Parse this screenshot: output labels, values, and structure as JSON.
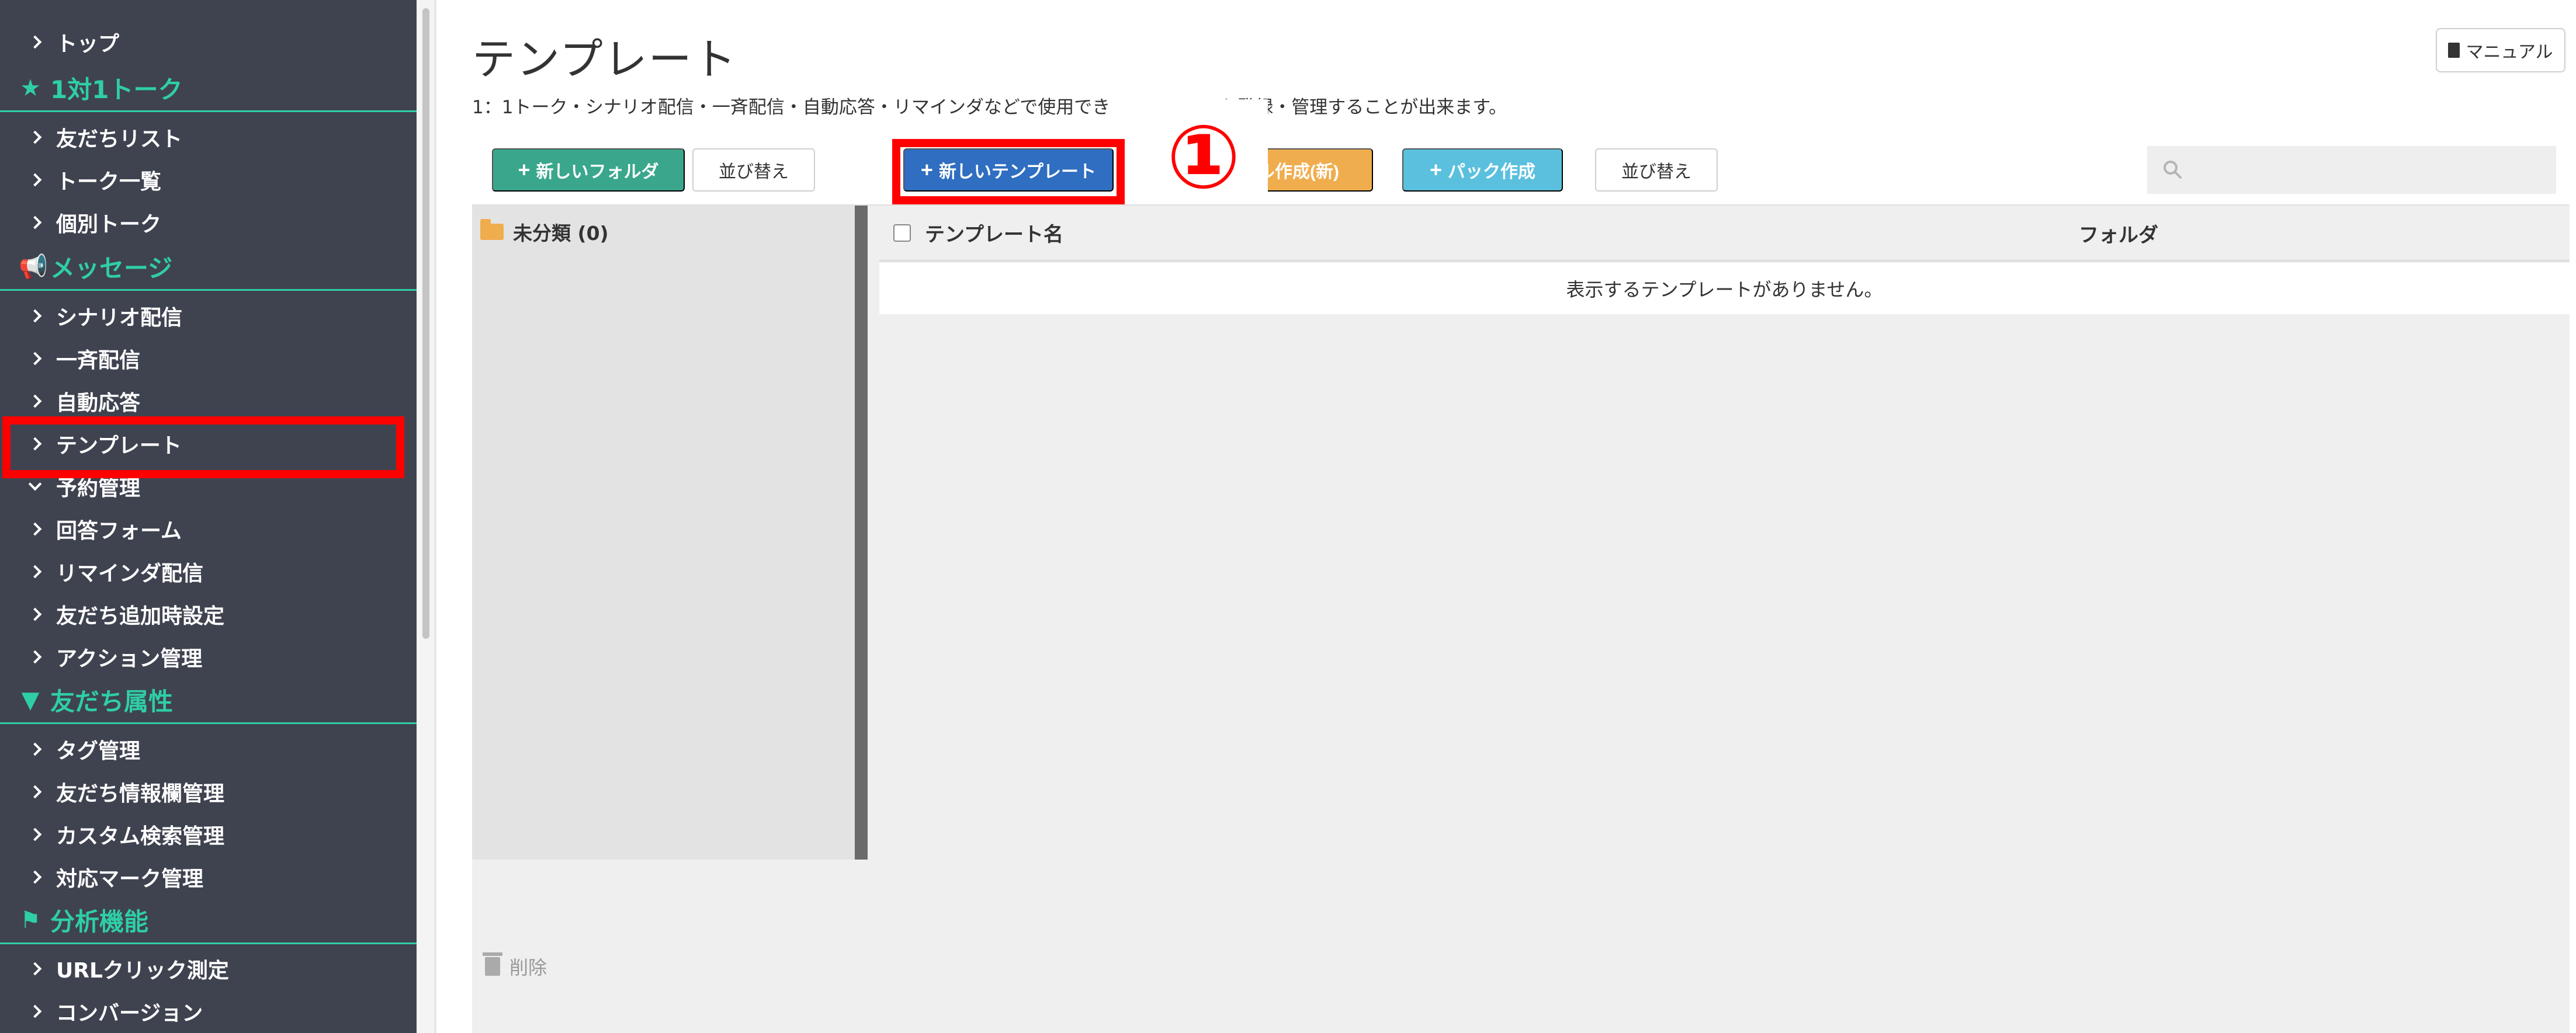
{
  "sidebar": {
    "items": [
      {
        "type": "item",
        "label": "トップ"
      },
      {
        "type": "section",
        "label": "1対1トーク",
        "icon": "star-icon"
      },
      {
        "type": "item",
        "label": "友だちリスト"
      },
      {
        "type": "item",
        "label": "トーク一覧"
      },
      {
        "type": "item",
        "label": "個別トーク"
      },
      {
        "type": "section",
        "label": "メッセージ",
        "icon": "megaphone-icon"
      },
      {
        "type": "item",
        "label": "シナリオ配信"
      },
      {
        "type": "item",
        "label": "一斉配信"
      },
      {
        "type": "item",
        "label": "自動応答"
      },
      {
        "type": "item",
        "label": "テンプレート",
        "highlighted": true
      },
      {
        "type": "item",
        "label": "予約管理",
        "expanded": true
      },
      {
        "type": "item",
        "label": "回答フォーム"
      },
      {
        "type": "item",
        "label": "リマインダ配信"
      },
      {
        "type": "item",
        "label": "友だち追加時設定"
      },
      {
        "type": "item",
        "label": "アクション管理"
      },
      {
        "type": "section",
        "label": "友だち属性",
        "icon": "filter-icon"
      },
      {
        "type": "item",
        "label": "タグ管理"
      },
      {
        "type": "item",
        "label": "友だち情報欄管理"
      },
      {
        "type": "item",
        "label": "カスタム検索管理"
      },
      {
        "type": "item",
        "label": "対応マーク管理"
      },
      {
        "type": "section",
        "label": "分析機能",
        "icon": "flag-icon"
      },
      {
        "type": "item",
        "label": "URLクリック測定"
      },
      {
        "type": "item",
        "label": "コンバージョン"
      }
    ]
  },
  "header": {
    "title": "テンプレート",
    "description": "1：1トーク・シナリオ配信・一斉配信・自動応答・リマインダなどで使用でき　　　　　　を登録・管理することが出来ます。",
    "manual_label": "マニュアル"
  },
  "toolbar": {
    "new_folder": "新しいフォルダ",
    "sort_left": "並び替え",
    "new_template": "新しいテンプレート",
    "bulk_create": "ル作成(新)",
    "pack_create": "パック作成",
    "sort_right": "並び替え",
    "search_placeholder": ""
  },
  "annotation": {
    "number": "①",
    "color": "#ff0000"
  },
  "folders": {
    "uncategorized": "未分類 (0)"
  },
  "table": {
    "col_name": "テンプレート名",
    "col_folder": "フォルダ",
    "empty_message": "表示するテンプレートがありません。"
  },
  "footer": {
    "delete_label": "削除"
  },
  "colors": {
    "sidebar_bg": "#3f4350",
    "accent_green": "#2fcea6",
    "btn_green": "#3aa78c",
    "btn_blue": "#2f6ec0",
    "btn_orange": "#f0ad4e",
    "btn_cyan": "#5bc0de",
    "highlight_red": "#ff0000"
  }
}
